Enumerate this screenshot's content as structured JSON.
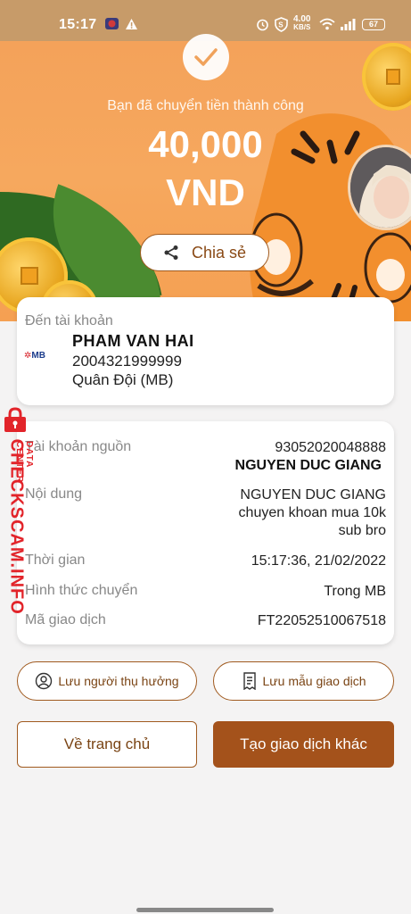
{
  "status_bar": {
    "time": "15:17",
    "speed_value": "4.00",
    "speed_unit": "KB/S",
    "battery": "67"
  },
  "hero": {
    "success_text": "Bạn đã chuyển tiền thành công",
    "amount": "40,000",
    "currency": "VND",
    "share_label": "Chia sẻ"
  },
  "recipient": {
    "label": "Đến tài khoản",
    "bank_logo": "MB",
    "name": "PHAM VAN HAI",
    "account_number": "2004321999999",
    "bank_name": "Quân Đội (MB)"
  },
  "details": {
    "source_label": "Tài khoản nguồn",
    "source_account": "93052020048888",
    "source_name": "NGUYEN DUC GIANG",
    "content_label": "Nội dung",
    "content_line1": "NGUYEN DUC GIANG",
    "content_line2": "chuyen khoan mua 10k",
    "content_line3": "sub bro",
    "time_label": "Thời gian",
    "time_value": "15:17:36, 21/02/2022",
    "method_label": "Hình thức chuyển",
    "method_value": "Trong MB",
    "code_label": "Mã giao dịch",
    "code_value": "FT22052510067518"
  },
  "actions": {
    "save_beneficiary": "Lưu người thụ hưởng",
    "save_template": "Lưu mẫu giao dịch",
    "home": "Về trang chủ",
    "new_transaction": "Tạo giao dịch khác"
  },
  "watermark": {
    "main": "CHECKSCAM.INFO",
    "sub": "DATA CENTER"
  },
  "colors": {
    "accent": "#a4521b",
    "hero": "#f5a052",
    "watermark": "#e2242a"
  }
}
